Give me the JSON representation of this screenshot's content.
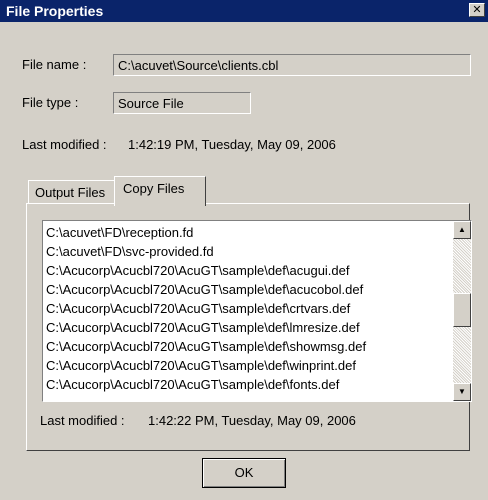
{
  "window": {
    "title": "File Properties",
    "close_glyph": "✕"
  },
  "file_name": {
    "label": "File name :",
    "value": "C:\\acuvet\\Source\\clients.cbl"
  },
  "file_type": {
    "label": "File type :",
    "value": "Source File"
  },
  "last_modified": {
    "label": "Last modified :",
    "value": "1:42:19 PM, Tuesday, May 09, 2006"
  },
  "tabs": [
    {
      "label": "Output Files",
      "selected": false
    },
    {
      "label": "Copy Files",
      "selected": true
    }
  ],
  "copy_files": {
    "items": [
      "C:\\acuvet\\FD\\reception.fd",
      "C:\\acuvet\\FD\\svc-provided.fd",
      "C:\\Acucorp\\Acucbl720\\AcuGT\\sample\\def\\acugui.def",
      "C:\\Acucorp\\Acucbl720\\AcuGT\\sample\\def\\acucobol.def",
      "C:\\Acucorp\\Acucbl720\\AcuGT\\sample\\def\\crtvars.def",
      "C:\\Acucorp\\Acucbl720\\AcuGT\\sample\\def\\lmresize.def",
      "C:\\Acucorp\\Acucbl720\\AcuGT\\sample\\def\\showmsg.def",
      "C:\\Acucorp\\Acucbl720\\AcuGT\\sample\\def\\winprint.def",
      "C:\\Acucorp\\Acucbl720\\AcuGT\\sample\\def\\fonts.def"
    ],
    "last_modified_label": "Last modified :",
    "last_modified_value": "1:42:22 PM, Tuesday, May 09, 2006"
  },
  "ok_label": "OK",
  "colors": {
    "titlebar": "#0a246a",
    "face": "#d4d0c8"
  }
}
